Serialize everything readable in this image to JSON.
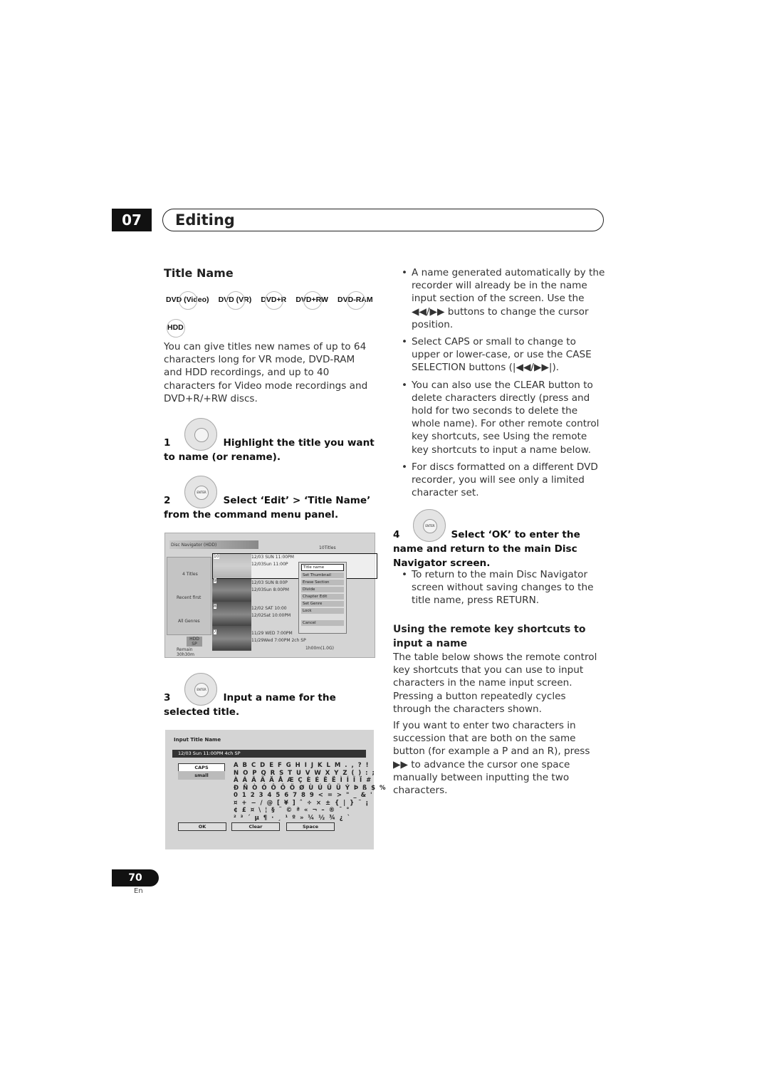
{
  "chapter": {
    "number": "07",
    "title": "Editing"
  },
  "section_title": "Title Name",
  "formats": [
    "DVD (Video)",
    "DVD (VR)",
    "DVD+R",
    "DVD+RW",
    "DVD-RAM"
  ],
  "format_hdd": "HDD",
  "intro": "You can give titles new names of up to 64 characters long for VR mode, DVD-RAM and HDD recordings, and up to 40 characters for Video mode recordings and DVD+R/+RW discs.",
  "steps": [
    {
      "num": "1",
      "text": "Highlight the title you want to name (or rename)."
    },
    {
      "num": "2",
      "text": "Select ‘Edit’ > ‘Title Name’ from the command menu panel."
    },
    {
      "num": "3",
      "text": "Input a name for the selected title."
    },
    {
      "num": "4",
      "text": "Select ‘OK’ to enter the name and return to the main Disc Navigator screen."
    }
  ],
  "navigator": {
    "header": "Disc Navigator (HDD)",
    "count": "10Titles",
    "side": [
      "4 Titles",
      "Recent first",
      "All Genres"
    ],
    "media": "HDD SP",
    "remain": "Remain 30h30m",
    "titles": [
      {
        "n": "10",
        "l1": "12/03 SUN 11:00PM",
        "l2": "12/03Sun 11:00P"
      },
      {
        "n": "9",
        "l1": "12/03 SUN 8:00P",
        "l2": "12/03Sun 8:00PM"
      },
      {
        "n": "8",
        "l1": "12/02 SAT 10:00",
        "l2": "12/02Sat 10:00PM"
      },
      {
        "n": "7",
        "l1": "11/29 WED 7:00PM",
        "l2": "11/29Wed 7:00PM 2ch SP",
        "l3": "1h00m(1.0G)"
      }
    ],
    "menu": [
      "Title name",
      "Set Thumbnail",
      "Erase Section",
      "Divide",
      "Chapter Edit",
      "Set Genre",
      "Lock",
      "Cancel"
    ]
  },
  "input_screen": {
    "title": "Input Title Name",
    "value": "12/03 Sun 11:00PM 4ch SP",
    "caps": "CAPS",
    "small": "small",
    "keyboard": "A B C D E F G H I J K L M . , ? !\nN O P Q R S T U V W X Y Z ( ) : ;\nÀ Á Â Ã Ä Å Æ Ç È É Ê Ë Ì Í Î Ï #\nÐ Ñ Ò Ó Ô Õ Ö Ø Ù Ú Û Ü Ý Þ ß $ %\n0 1 2 3 4 5 6 7 8 9 < = > \" _ & '\n¤ + − / @ [ ¥ ] ˆ ÷ × ± { | } ˜ ¡\n¢ £ ¤ \\ ¦ § ¨ © ª « ¬ – ® ¯ °\n² ³ ´ µ ¶ · ¸ ¹ º » ¼ ½ ¾ ¿ `",
    "ok": "OK",
    "clear": "Clear",
    "space": "Space"
  },
  "right": {
    "bullets1": [
      "A name generated automatically by the recorder will already be in the name input section of the screen. Use the ◀◀/▶▶ buttons to change the cursor position.",
      "Select CAPS or small to change to upper or lower-case, or use the CASE SELECTION buttons (|◀◀/▶▶|).",
      "You can also use the CLEAR button to delete characters directly (press and hold for two seconds to delete the whole name). For other remote control key shortcuts, see Using the remote key shortcuts to input a name below.",
      "For discs formatted on a different DVD recorder, you will see only a limited character set."
    ],
    "bullet2": "To return to the main Disc Navigator screen without saving changes to the title name, press RETURN.",
    "sub_heading": "Using the remote key shortcuts to input a name",
    "para1": "The table below shows the remote control key shortcuts that you can use to input characters in the name input screen. Pressing a button repeatedly cycles through the characters shown.",
    "para2": "If you want to enter two characters in succession that are both on the same button (for example a P and an R), press ▶▶ to advance the cursor one space manually between inputting the two characters."
  },
  "footer": {
    "page": "70",
    "lang": "En"
  }
}
